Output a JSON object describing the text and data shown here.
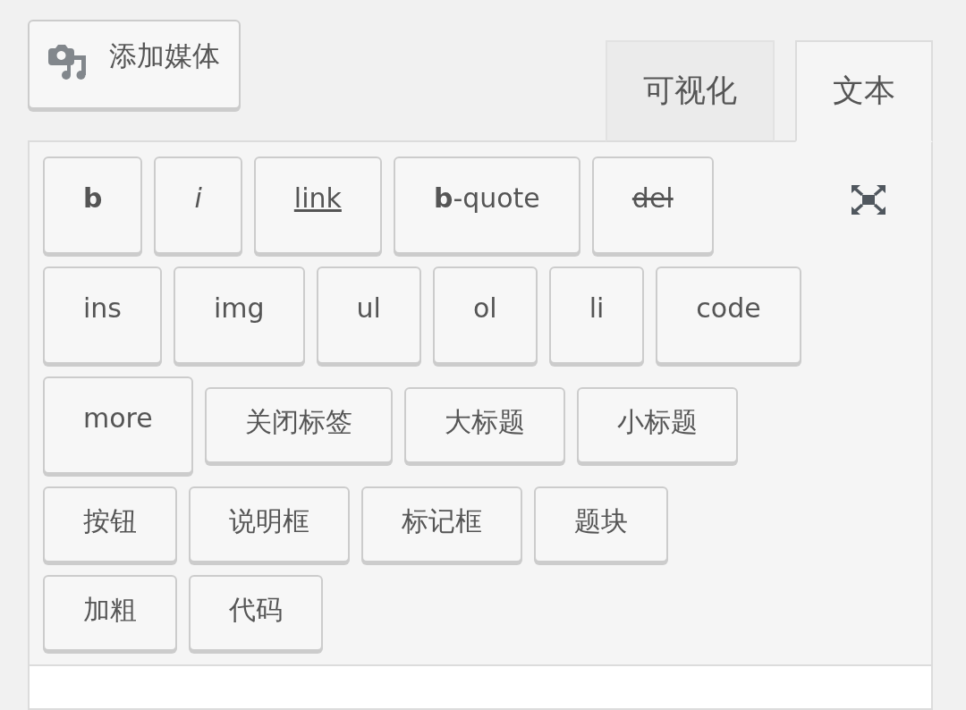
{
  "media_button": {
    "label": "添加媒体"
  },
  "tabs": [
    {
      "label": "可视化",
      "selected": false
    },
    {
      "label": "文本",
      "selected": true
    }
  ],
  "toolbar": {
    "rows": [
      {
        "buttons": [
          {
            "label": "b",
            "kind": "bold"
          },
          {
            "label": "i",
            "kind": "italic"
          },
          {
            "label": "link",
            "kind": "link"
          },
          {
            "label": "**b**-quote",
            "kind": "tag"
          },
          {
            "label": "del",
            "kind": "strike"
          }
        ]
      },
      {
        "buttons": [
          {
            "label": "ins",
            "kind": "tag"
          },
          {
            "label": "img",
            "kind": "tag"
          },
          {
            "label": "ul",
            "kind": "tag"
          },
          {
            "label": "ol",
            "kind": "tag"
          },
          {
            "label": "li",
            "kind": "tag"
          },
          {
            "label": "code",
            "kind": "tag"
          }
        ]
      },
      {
        "buttons": [
          {
            "label": "more",
            "kind": "tag"
          },
          {
            "label": "关闭标签",
            "kind": "custom"
          },
          {
            "label": "大标题",
            "kind": "custom"
          },
          {
            "label": "小标题",
            "kind": "custom"
          }
        ]
      },
      {
        "buttons": [
          {
            "label": "按钮",
            "kind": "custom"
          },
          {
            "label": "说明框",
            "kind": "custom"
          },
          {
            "label": "标记框",
            "kind": "custom"
          },
          {
            "label": "题块",
            "kind": "custom"
          }
        ]
      },
      {
        "buttons": [
          {
            "label": "加粗",
            "kind": "custom"
          },
          {
            "label": "代码",
            "kind": "custom"
          }
        ]
      }
    ]
  }
}
